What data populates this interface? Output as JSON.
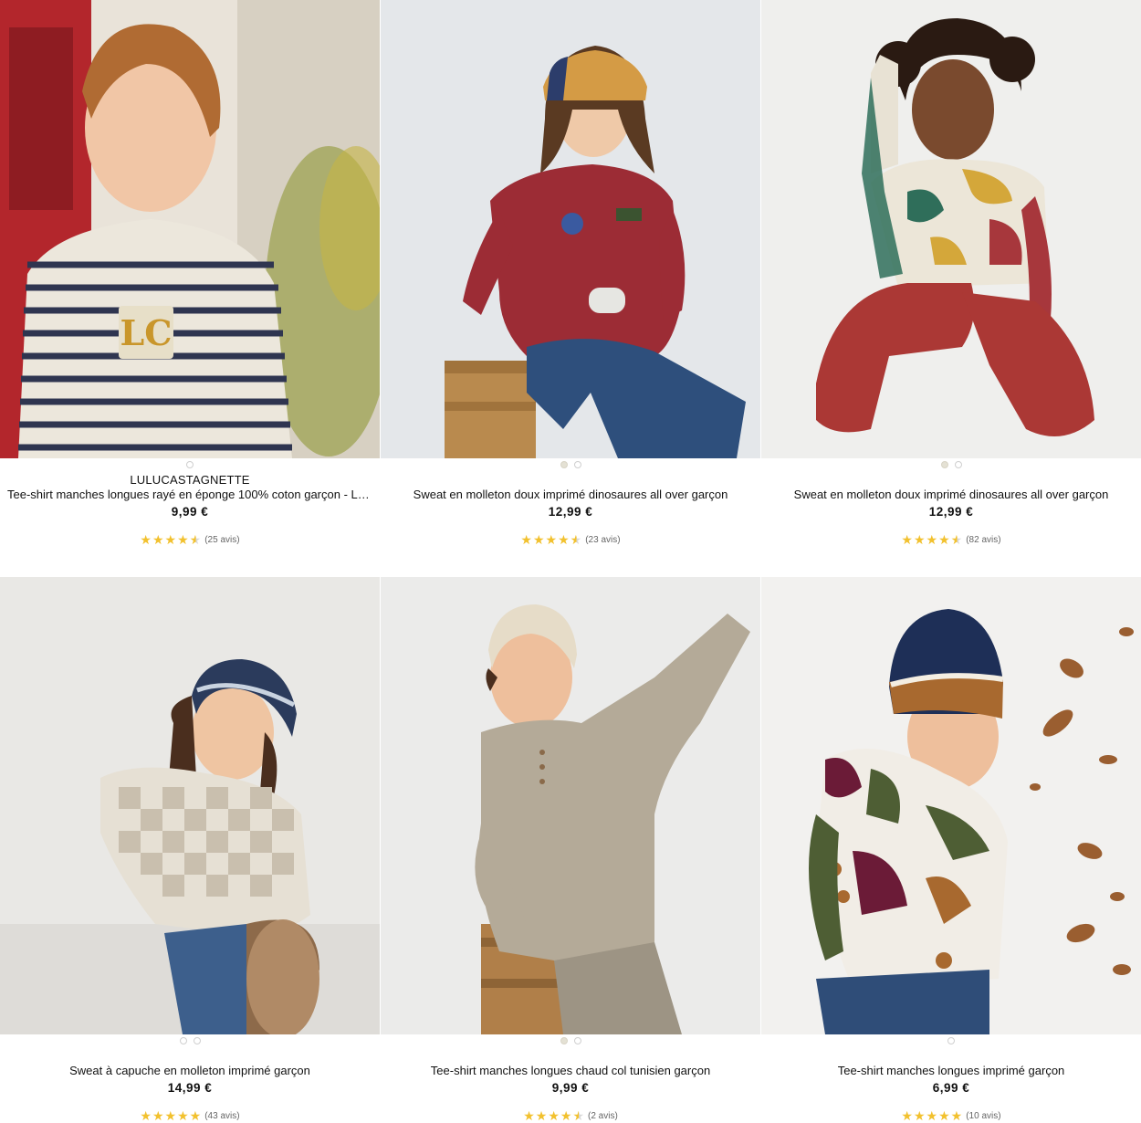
{
  "products": [
    {
      "brand": "LULUCASTAGNETTE",
      "title": "Tee-shirt manches longues rayé en éponge 100% coton garçon - Lu…",
      "price": "9,99 €",
      "reviews": "(25 avis)",
      "rating": 4.5,
      "image_dots": 1,
      "active_dot": -1,
      "image_desc": "boy-striped-tee"
    },
    {
      "brand": "",
      "title": "Sweat en molleton doux imprimé dinosaures all over garçon",
      "price": "12,99 €",
      "reviews": "(23 avis)",
      "rating": 4.5,
      "image_dots": 2,
      "active_dot": 0,
      "image_desc": "boy-red-sweat-crate"
    },
    {
      "brand": "",
      "title": "Sweat en molleton doux imprimé dinosaures all over garçon",
      "price": "12,99 €",
      "reviews": "(82 avis)",
      "rating": 4.5,
      "image_dots": 2,
      "active_dot": 0,
      "image_desc": "boy-camo-sweat-kneeling"
    },
    {
      "brand": "",
      "title": "Sweat à capuche en molleton imprimé garçon",
      "price": "14,99 €",
      "reviews": "(43 avis)",
      "rating": 5,
      "image_dots": 2,
      "active_dot": -1,
      "image_desc": "boy-checkered-hoodie"
    },
    {
      "brand": "",
      "title": "Tee-shirt manches longues chaud col tunisien garçon",
      "price": "9,99 €",
      "reviews": "(2 avis)",
      "rating": 4.5,
      "image_dots": 2,
      "active_dot": 0,
      "image_desc": "boy-beige-henley"
    },
    {
      "brand": "",
      "title": "Tee-shirt manches longues imprimé garçon",
      "price": "6,99 €",
      "reviews": "(10 avis)",
      "rating": 5,
      "image_dots": 1,
      "active_dot": -1,
      "image_desc": "boy-print-tee-leaves"
    }
  ],
  "colors": {
    "star": "#f2c12e",
    "background": "#ffffff",
    "text": "#111111"
  }
}
